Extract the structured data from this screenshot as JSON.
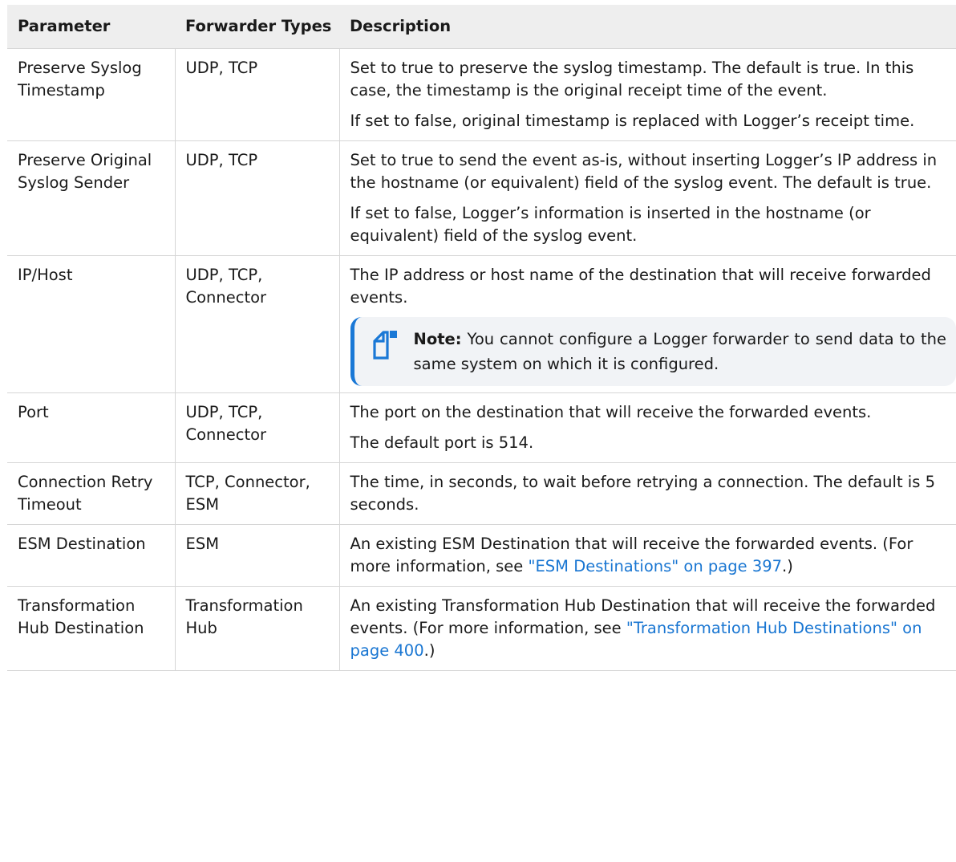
{
  "table": {
    "headers": [
      "Parameter",
      "Forwarder Types",
      "Description"
    ],
    "rows": [
      {
        "parameter": "Preserve Syslog Timestamp",
        "types": "UDP, TCP",
        "p1": "Set to true to preserve the syslog timestamp. The default is true. In this case, the timestamp is the original receipt time of the event.",
        "p2": "If set to false, original timestamp is replaced with Logger’s receipt time."
      },
      {
        "parameter": "Preserve Original Syslog Sender",
        "types": "UDP, TCP",
        "p1": "Set to true to send the event as-is, without inserting Logger’s IP address in the hostname (or equivalent) field of the syslog event. The default is true.",
        "p2": "If set to false, Logger’s information is inserted in the hostname (or equivalent) field of the syslog event."
      },
      {
        "parameter": "IP/Host",
        "types": "UDP, TCP, Connector",
        "p1": "The IP address or host name of the destination that will receive forwarded events.",
        "note_label": "Note:",
        "note_text": " You cannot configure a Logger forwarder to send data to the same system on which it is configured."
      },
      {
        "parameter": "Port",
        "types": "UDP, TCP, Connector",
        "p1": "The port on the destination that will receive the forwarded events.",
        "p2": "The default port is 514."
      },
      {
        "parameter": "Connection Retry Timeout",
        "types": "TCP, Connector, ESM",
        "p1": "The time, in seconds, to wait before retrying a connection. The default is 5 seconds."
      },
      {
        "parameter": "ESM Destination",
        "types": "ESM",
        "p1_pre": "An existing ESM Destination that will receive the forwarded events. (For more information, see ",
        "p1_link": "\"ESM Destinations\" on page 397",
        "p1_post": ".)"
      },
      {
        "parameter": "Transformation Hub Destination",
        "types": "Transformation Hub",
        "p1_pre": "An existing Transformation Hub Destination that will receive the forwarded events. (For more information, see ",
        "p1_link": "\"Transformation Hub Destinations\" on page 400",
        "p1_post": ".)"
      }
    ]
  },
  "colors": {
    "header_bg": "#eeeeee",
    "link": "#1976d2",
    "note_accent": "#1a78d6",
    "note_bg": "#f1f3f6",
    "rule": "#d6d6d6"
  },
  "icons": {
    "note": "note-icon"
  }
}
